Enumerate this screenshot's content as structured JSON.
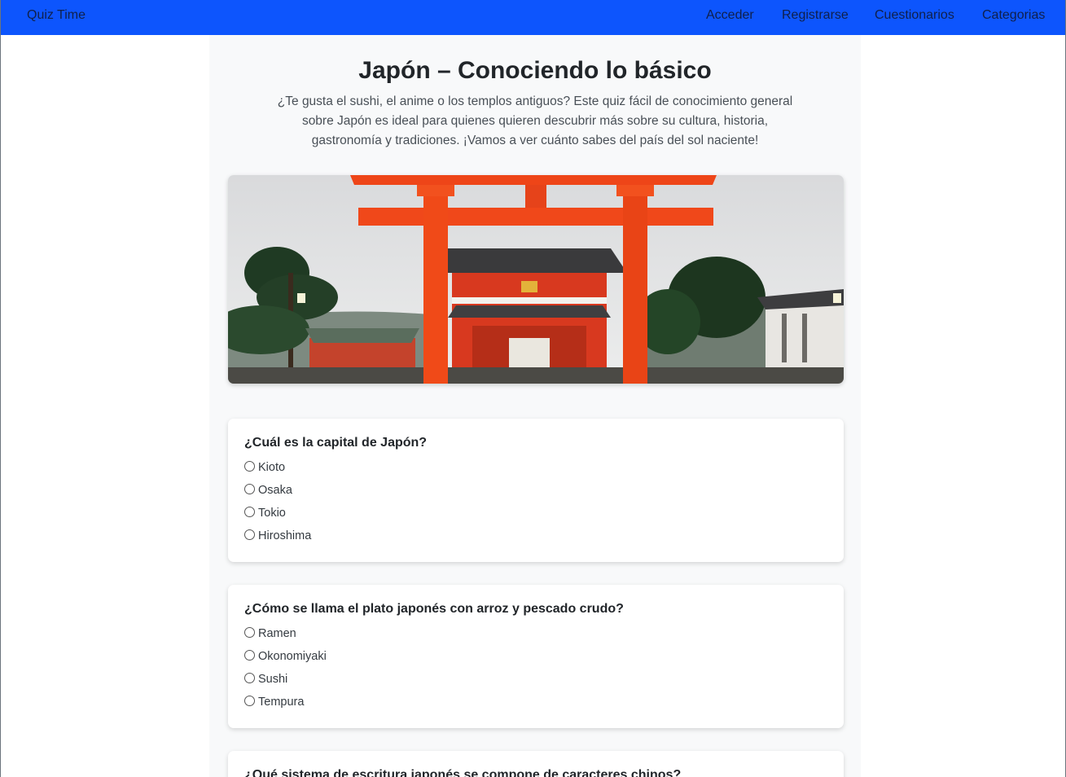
{
  "navbar": {
    "brand": "Quiz Time",
    "links": [
      "Acceder",
      "Registrarse",
      "Cuestionarios",
      "Categorias"
    ],
    "background": "#0d55fd"
  },
  "quiz": {
    "title": "Japón – Conociendo lo básico",
    "description": "¿Te gusta el sushi, el anime o los templos antiguos? Este quiz fácil de conocimiento general sobre Japón es ideal para quienes quieren descubrir más sobre su cultura, historia, gastronomía y tradiciones. ¡Vamos a ver cuánto sabes del país del sol naciente!"
  },
  "questions": [
    {
      "text": "¿Cuál es la capital de Japón?",
      "options": [
        "Kioto",
        "Osaka",
        "Tokio",
        "Hiroshima"
      ]
    },
    {
      "text": "¿Cómo se llama el plato japonés con arroz y pescado crudo?",
      "options": [
        "Ramen",
        "Okonomiyaki",
        "Sushi",
        "Tempura"
      ]
    },
    {
      "text": "¿Qué sistema de escritura japonés se compone de caracteres chinos?",
      "options": []
    }
  ]
}
